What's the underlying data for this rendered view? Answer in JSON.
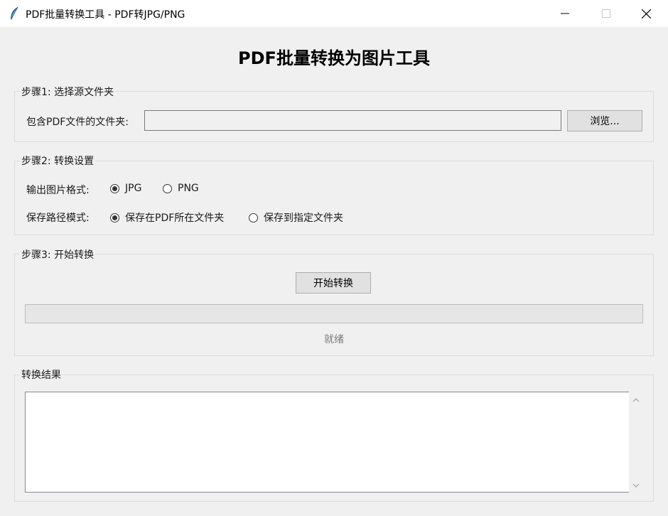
{
  "window": {
    "title": "PDF批量转换工具 - PDF转JPG/PNG",
    "app_icon": "feather-icon",
    "controls": [
      "minimize-icon",
      "maximize-icon",
      "close-icon"
    ]
  },
  "heading": "PDF批量转换为图片工具",
  "step1": {
    "legend": "步骤1: 选择源文件夹",
    "folder_label": "包含PDF文件的文件夹:",
    "folder_value": "",
    "browse_label": "浏览..."
  },
  "step2": {
    "legend": "步骤2: 转换设置",
    "format_label": "输出图片格式:",
    "format_options": [
      {
        "label": "JPG",
        "selected": true
      },
      {
        "label": "PNG",
        "selected": false
      }
    ],
    "path_label": "保存路径模式:",
    "path_options": [
      {
        "label": "保存在PDF所在文件夹",
        "selected": true
      },
      {
        "label": "保存到指定文件夹",
        "selected": false
      }
    ]
  },
  "step3": {
    "legend": "步骤3: 开始转换",
    "start_label": "开始转换",
    "progress": 0,
    "status": "就绪"
  },
  "results": {
    "legend": "转换结果",
    "text": ""
  },
  "colors": {
    "window_bg": "#f0f0f0",
    "titlebar_bg": "#ffffff",
    "progress_fill": "#06b025"
  }
}
